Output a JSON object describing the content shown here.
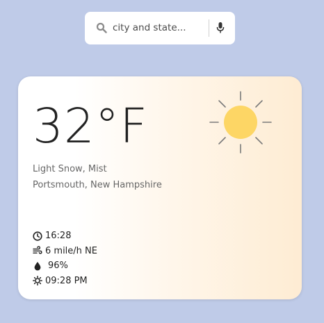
{
  "search": {
    "placeholder": "city and state...",
    "value": ""
  },
  "weather": {
    "temperature": "32°F",
    "condition": "Light Snow, Mist",
    "location": "Portsmouth, New Hampshire",
    "time": "16:28",
    "wind": "6 mile/h NE",
    "humidity": "96%",
    "sunset": "09:28 PM",
    "icon": "sun-icon"
  },
  "colors": {
    "background": "#bfcbe8",
    "sun": "#fdd665",
    "card_gradient_end": "#feecd3"
  }
}
